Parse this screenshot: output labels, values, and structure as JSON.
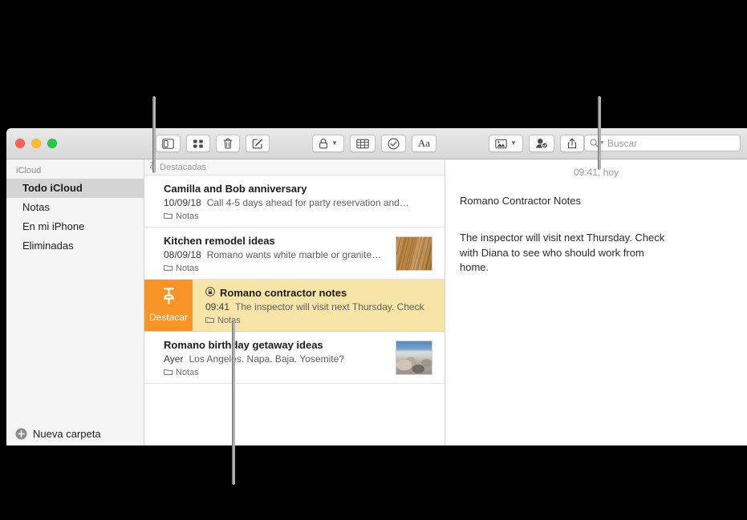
{
  "window": {
    "traffic_lights": [
      "close",
      "minimize",
      "zoom"
    ],
    "colors": {
      "close": "#ff5f57",
      "minimize": "#febc2e",
      "zoom": "#28c840",
      "accent_swipe": "#f79425",
      "selected_row": "#f7e5a8",
      "sidebar_selected": "#d4d4d4"
    }
  },
  "toolbar": {
    "left_group": [
      {
        "name": "sidebar-toggle-button",
        "icon": "sidebar-icon"
      },
      {
        "name": "gallery-view-button",
        "icon": "grid-icon"
      },
      {
        "name": "delete-note-button",
        "icon": "trash-icon"
      },
      {
        "name": "new-note-button",
        "icon": "compose-icon"
      }
    ],
    "mid_group": [
      {
        "name": "lock-note-button",
        "icon": "lock-icon",
        "has_chevron": true
      },
      {
        "name": "table-button",
        "icon": "table-icon"
      },
      {
        "name": "checklist-button",
        "icon": "checkmark-circle-icon"
      },
      {
        "name": "format-button",
        "icon": "aa-icon",
        "label": "Aa"
      }
    ],
    "right_group": [
      {
        "name": "media-button",
        "icon": "photo-icon",
        "has_chevron": true
      },
      {
        "name": "add-people-button",
        "icon": "person-check-icon"
      },
      {
        "name": "share-button",
        "icon": "share-icon"
      }
    ]
  },
  "search": {
    "placeholder": "Buscar",
    "icon": "search-icon",
    "chevron": "▾"
  },
  "sidebar": {
    "header": "iCloud",
    "items": [
      {
        "label": "Todo iCloud",
        "selected": true
      },
      {
        "label": "Notas",
        "selected": false
      },
      {
        "label": "En mi iPhone",
        "selected": false
      },
      {
        "label": "Eliminadas",
        "selected": false
      }
    ],
    "new_folder_label": "Nueva carpeta",
    "new_folder_icon": "plus-circle-icon"
  },
  "note_list": {
    "section_header": "Destacadas",
    "section_icon": "pin-icon",
    "swipe_action": {
      "label": "Destacar",
      "icon": "pin-icon",
      "color": "#f79425"
    },
    "notes": [
      {
        "title": "Camilla and Bob anniversary",
        "date": "10/09/18",
        "preview": "Call 4-5 days ahead for party reservation and…",
        "folder": "Notas",
        "selected": false,
        "locked": false,
        "thumbnail": null
      },
      {
        "title": "Kitchen remodel ideas",
        "date": "08/09/18",
        "preview": "Romano wants white marble or granite…",
        "folder": "Notas",
        "selected": false,
        "locked": false,
        "thumbnail": "wood"
      },
      {
        "title": "Romano contractor notes",
        "date": "09:41",
        "preview": "The inspector will visit next Thursday. Check",
        "folder": "Notas",
        "selected": true,
        "locked": true,
        "thumbnail": null
      },
      {
        "title": "Romano birthday getaway ideas",
        "date": "Ayer",
        "preview": "Los Angeles. Napa. Baja. Yosemite?",
        "folder": "Notas",
        "selected": false,
        "locked": false,
        "thumbnail": "beach"
      }
    ]
  },
  "detail": {
    "date": "09:41, hoy",
    "title_line": "Romano Contractor Notes",
    "body": "The inspector will visit next Thursday. Check with Diana to see who should work from home."
  }
}
